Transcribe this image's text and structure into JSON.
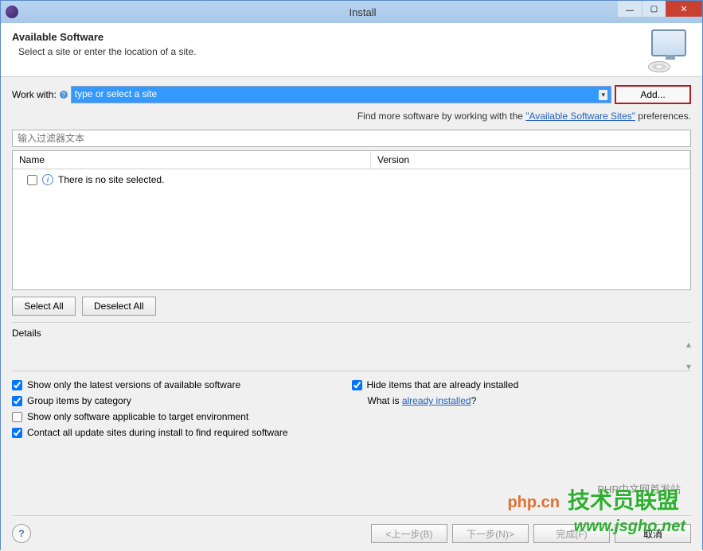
{
  "window": {
    "title": "Install"
  },
  "banner": {
    "heading": "Available Software",
    "subtext": "Select a site or enter the location of a site."
  },
  "workWith": {
    "label": "Work with:",
    "placeholder": "type or select a site",
    "addLabel": "Add..."
  },
  "findMore": {
    "prefix": "Find more software by working with the ",
    "link": "\"Available Software Sites\"",
    "suffix": " preferences."
  },
  "filter": {
    "placeholder": "输入过滤器文本"
  },
  "tree": {
    "cols": {
      "name": "Name",
      "version": "Version"
    },
    "empty": "There is no site selected."
  },
  "selButtons": {
    "selectAll": "Select All",
    "deselectAll": "Deselect All"
  },
  "details": {
    "heading": "Details"
  },
  "opts": {
    "latest": "Show only the latest versions of available software",
    "group": "Group items by category",
    "target": "Show only software applicable to target environment",
    "contact": "Contact all update sites during install to find required software",
    "hide": "Hide items that are already installed",
    "whatIsPrefix": "What is ",
    "whatIsLink": "already installed",
    "whatIsSuffix": "?"
  },
  "footer": {
    "back": "<上一步(B)",
    "next": "下一步(N)>",
    "finish": "完成(F)",
    "cancel": "取消"
  },
  "watermark": {
    "gray": "PHP中文网首发站",
    "orange": "php.cn",
    "green1": "技术员联盟",
    "green2": "www.jsgho.net"
  }
}
